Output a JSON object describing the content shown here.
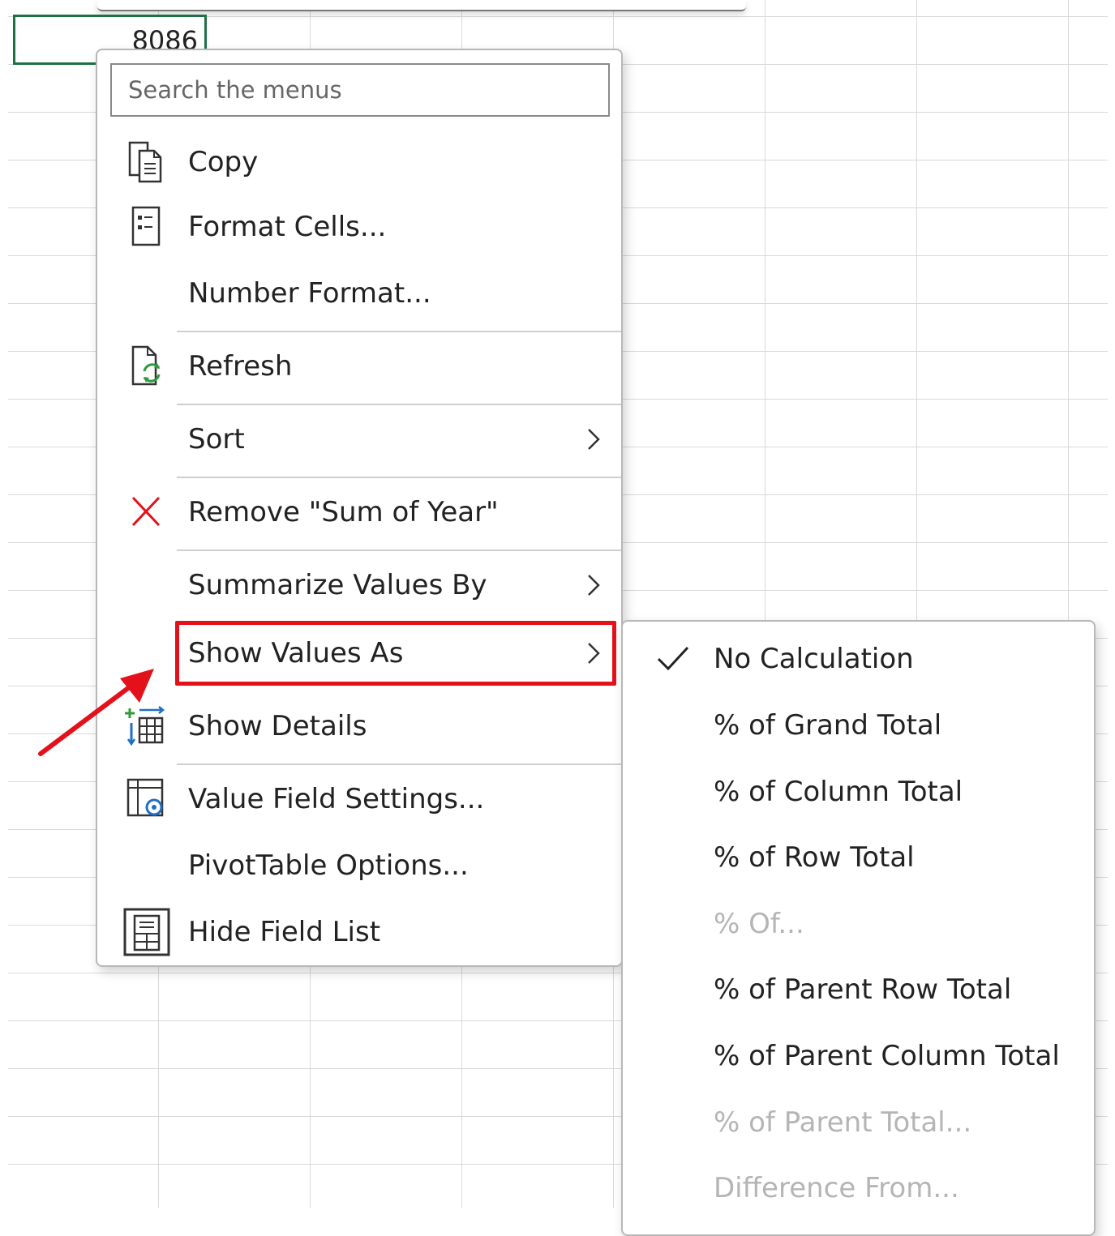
{
  "spreadsheet": {
    "active_cell_value": "8086"
  },
  "context_menu": {
    "search_placeholder": "Search the menus",
    "items": {
      "copy": "Copy",
      "format_cells": "Format Cells...",
      "number_format": "Number Format...",
      "refresh": "Refresh",
      "sort": "Sort",
      "remove_field": "Remove \"Sum of Year\"",
      "summarize_values_by": "Summarize Values By",
      "show_values_as": "Show Values As",
      "show_details": "Show Details",
      "value_field_settings": "Value Field Settings...",
      "pivottable_options": "PivotTable Options...",
      "hide_field_list": "Hide Field List"
    }
  },
  "show_values_as_submenu": {
    "items": [
      {
        "label": "No Calculation",
        "checked": true,
        "enabled": true
      },
      {
        "label": "% of Grand Total",
        "checked": false,
        "enabled": true
      },
      {
        "label": "% of Column Total",
        "checked": false,
        "enabled": true
      },
      {
        "label": "% of Row Total",
        "checked": false,
        "enabled": true
      },
      {
        "label": "% Of...",
        "checked": false,
        "enabled": false
      },
      {
        "label": "% of Parent Row Total",
        "checked": false,
        "enabled": true
      },
      {
        "label": "% of Parent Column Total",
        "checked": false,
        "enabled": true
      },
      {
        "label": "% of Parent Total...",
        "checked": false,
        "enabled": false
      },
      {
        "label": "Difference From...",
        "checked": false,
        "enabled": false
      }
    ]
  },
  "colors": {
    "highlight_border": "#e3111a",
    "active_cell_border": "#1e7145",
    "refresh_icon_green": "#2e9b3e",
    "icon_blue": "#1f6fc4",
    "remove_icon_red": "#e3111a"
  },
  "icons": [
    "copy-icon",
    "format-cells-icon",
    "refresh-icon",
    "remove-x-icon",
    "show-details-icon",
    "value-field-settings-icon",
    "field-list-icon",
    "chevron-right-icon",
    "checkmark-icon"
  ]
}
